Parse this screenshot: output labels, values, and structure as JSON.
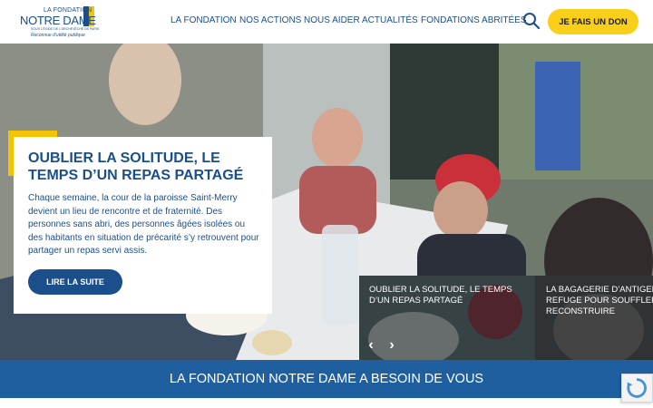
{
  "logo": {
    "line1": "LA FONDATION",
    "line2": "NOTRE DAME",
    "line3": "SOUS L'ÉGIDE DE L'ARCHEVÊCHÉ DE PARIS",
    "tagline": "Reconnue d'utilité publique",
    "colors": {
      "blue": "#1a4f8b",
      "yellow": "#f5c400"
    }
  },
  "nav": {
    "items": [
      {
        "label": "La fondation"
      },
      {
        "label": "Nos actions"
      },
      {
        "label": "Nous aider"
      },
      {
        "label": "Actualités"
      },
      {
        "label": "Fondations abritées"
      }
    ],
    "search_icon": "search-icon",
    "donate_label": "JE FAIS UN DON"
  },
  "hero": {
    "feature": {
      "title": "Oublier la solitude, le temps d’un repas partagé",
      "text": "Chaque semaine, la cour de la paroisse Saint-Merry devient un lieu de rencontre et de fraternité. Des personnes sans abri, des personnes âgées isolées ou des habitants en situation de précarité s’y retrouvent pour partager un repas servi assis.",
      "cta_label": "LIRE LA SUITE"
    },
    "thumbnails": [
      {
        "title": "Oublier la solitude, le temps d’un repas partagé"
      },
      {
        "title": "La Bagagerie d’Antigel, refuge pour souffler et reconstruire"
      }
    ],
    "arrows": {
      "prev": "‹",
      "next": "›"
    }
  },
  "banner": {
    "text": "La Fondation Notre Dame a besoin de vous"
  },
  "colors": {
    "primary": "#1a4f8b",
    "accent": "#f9cf1a",
    "banner": "#1f5fa0"
  }
}
